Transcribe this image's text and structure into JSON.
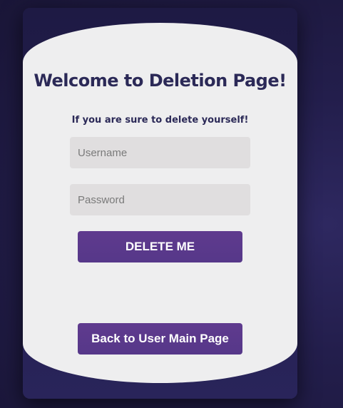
{
  "page": {
    "title": "Welcome to Deletion Page!",
    "subtitle": "If you are sure to delete yourself!"
  },
  "form": {
    "username_placeholder": "Username",
    "username_value": "",
    "password_placeholder": "Password",
    "password_value": "",
    "delete_label": "DELETE ME"
  },
  "nav": {
    "back_label": "Back to User Main Page"
  },
  "colors": {
    "background": "#231e4c",
    "card_panel": "#eeeeef",
    "heading": "#2b2957",
    "button": "#5a3a8a",
    "input_bg": "#e0dedf"
  }
}
